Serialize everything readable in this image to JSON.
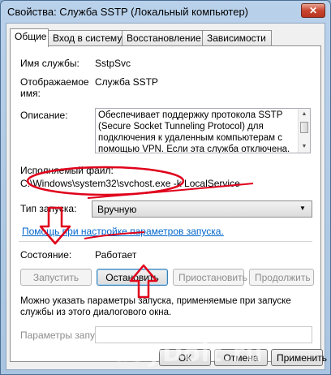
{
  "window": {
    "title": "Свойства: Служба SSTP (Локальный компьютер)",
    "close_glyph": "✕"
  },
  "tabs": [
    {
      "label": "Общие",
      "active": true
    },
    {
      "label": "Вход в систему",
      "active": false
    },
    {
      "label": "Восстановление",
      "active": false
    },
    {
      "label": "Зависимости",
      "active": false
    }
  ],
  "general": {
    "service_name_label": "Имя службы:",
    "service_name_value": "SstpSvc",
    "display_name_label_1": "Отображаемое",
    "display_name_label_2": "имя:",
    "display_name_value": "Служба SSTP",
    "description_label": "Описание:",
    "description_lines": [
      "Обеспечивает поддержку протокола SSTP",
      "(Secure Socket Tunneling Protocol) для",
      "подключения к удаленным компьютерам с",
      "помощью VPN. Если эта служба отключена."
    ],
    "exe_label": "Исполняемый файл:",
    "exe_value": "C:\\Windows\\system32\\svchost.exe -k LocalService",
    "startup_type_label": "Тип запуска:",
    "startup_type_value": "Вручную",
    "help_link": "Помощь при настройке параметров запуска.",
    "state_label": "Состояние:",
    "state_value": "Работает",
    "buttons": {
      "start": "Запустить",
      "stop": "Остановить",
      "pause": "Приостановить",
      "resume": "Продолжить"
    },
    "hint_line_1": "Можно указать параметры запуска, применяемые при запуске",
    "hint_line_2": "службы из этого диалогового окна.",
    "params_label": "Параметры запуска:",
    "params_value": ""
  },
  "footer": {
    "ok": "ОК",
    "cancel": "Отмена",
    "apply": "Применить"
  },
  "watermark": "EasyDoit.ru",
  "annotation_color": "#e0001b"
}
